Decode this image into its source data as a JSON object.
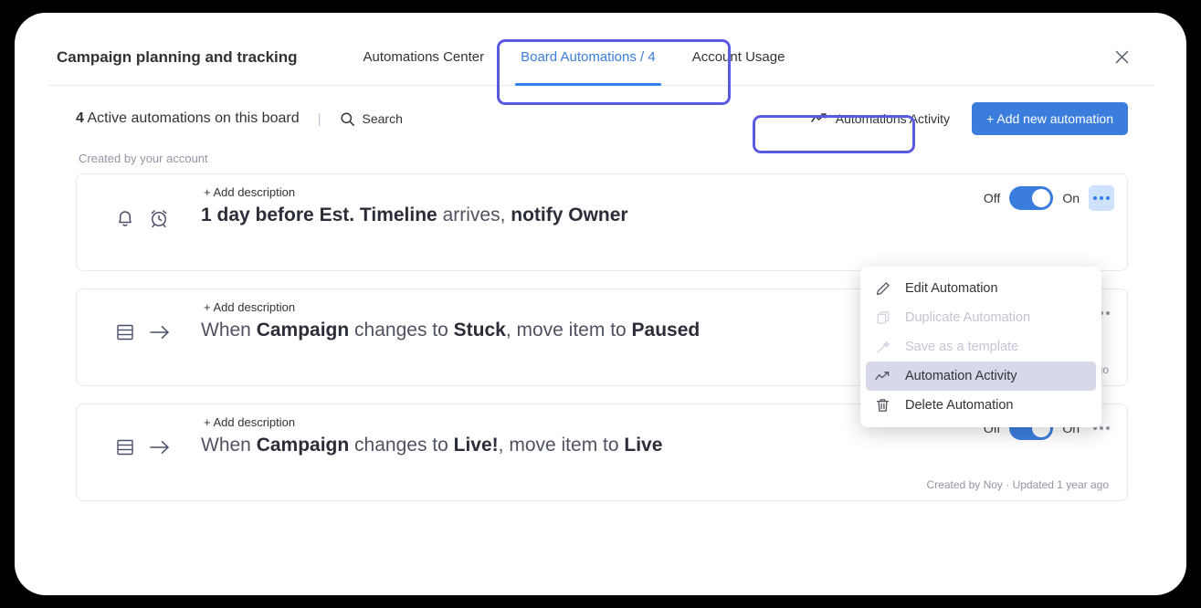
{
  "header": {
    "board_title": "Campaign planning and tracking",
    "close_icon": "close-icon",
    "tabs": [
      {
        "label": "Automations Center",
        "active": false
      },
      {
        "label": "Board Automations / 4",
        "active": true
      },
      {
        "label": "Account Usage",
        "active": false
      }
    ]
  },
  "subheader": {
    "count": "4",
    "count_text": " Active automations on this board",
    "divider": "|",
    "search_label": "Search",
    "search_icon": "search-icon",
    "activity_button_label": "Automations Activity",
    "activity_icon": "activity-line-icon",
    "add_button_label": "+ Add new automation"
  },
  "list": {
    "section_label": "Created by your account",
    "toggle_off_label": "Off",
    "toggle_on_label": "On",
    "add_description_label": "+ Add description",
    "cards": [
      {
        "icons": [
          "bell-icon",
          "alarm-clock-icon"
        ],
        "sentence_html": "<b>1 day before</b> <b>Est. Timeline</b> arrives, <b>notify Owner</b>",
        "sentence_text": "1 day before Est. Timeline arrives, notify Owner",
        "toggle_state": "on",
        "dots_active": true,
        "meta": ""
      },
      {
        "icons": [
          "status-rows-icon",
          "arrow-right-icon"
        ],
        "sentence_html": "When <b>Campaign</b> changes to <b>Stuck</b>, move item to <b>Paused</b>",
        "sentence_text": "When Campaign changes to Stuck, move item to Paused",
        "toggle_state": "on",
        "dots_active": false,
        "meta": "Created by Noy · Updated 1 year ago"
      },
      {
        "icons": [
          "status-rows-icon",
          "arrow-right-icon"
        ],
        "sentence_html": "When <b>Campaign</b> changes to <b>Live!</b>, move item to <b>Live</b>",
        "sentence_text": "When Campaign changes to Live!, move item to Live",
        "toggle_state": "on",
        "dots_active": false,
        "meta": "Created by Noy · Updated 1 year ago"
      }
    ]
  },
  "dropdown": {
    "items": [
      {
        "label": "Edit Automation",
        "icon": "pencil-icon",
        "state": "normal"
      },
      {
        "label": "Duplicate Automation",
        "icon": "duplicate-icon",
        "state": "disabled"
      },
      {
        "label": "Save as a template",
        "icon": "magic-wand-icon",
        "state": "disabled"
      },
      {
        "label": "Automation Activity",
        "icon": "activity-line-icon",
        "state": "highlighted"
      },
      {
        "label": "Delete Automation",
        "icon": "trash-icon",
        "state": "normal"
      }
    ]
  },
  "colors": {
    "accent_blue": "#3b7ddd",
    "tab_underline": "#2f80ed",
    "highlight_ring": "#5a5ae0",
    "menu_highlight": "#d6d9e8",
    "dots_active_bg": "#cfe2fd",
    "muted_text": "#9295a5"
  }
}
